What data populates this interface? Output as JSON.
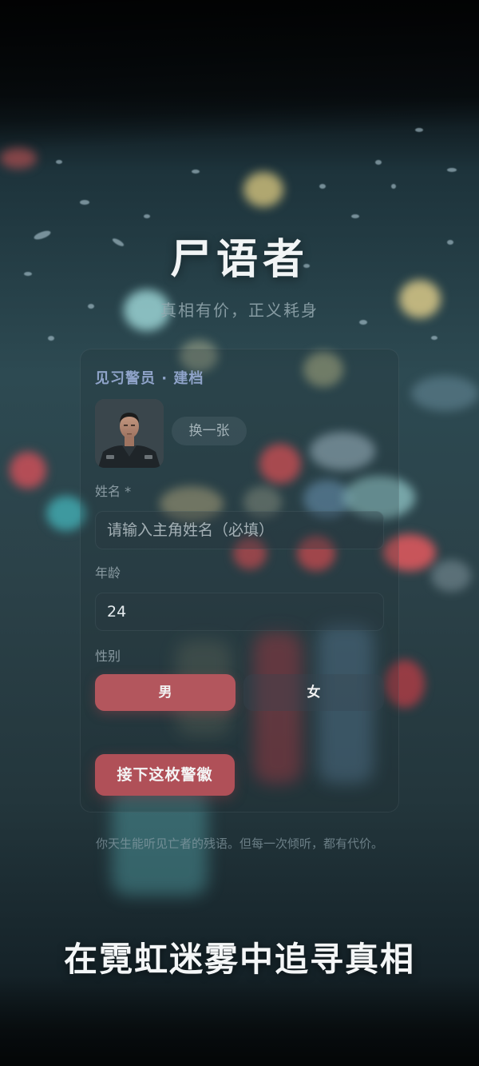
{
  "header": {
    "title": "尸语者",
    "subtitle": "真相有价，正义耗身"
  },
  "form": {
    "heading": "见习警员 · 建档",
    "avatar_icon": "portrait-photo",
    "change_photo_label": "换一张",
    "name": {
      "label": "姓名 *",
      "placeholder": "请输入主角姓名（必填）",
      "value": ""
    },
    "age": {
      "label": "年龄",
      "value": "24"
    },
    "gender": {
      "label": "性别",
      "options": [
        "男",
        "女"
      ],
      "selected": "男"
    },
    "submit_label": "接下这枚警徽"
  },
  "footnote": "你天生能听见亡者的残语。但每一次倾听，都有代价。",
  "tagline": "在霓虹迷雾中追寻真相",
  "colors": {
    "accent": "#b3565d",
    "heading": "#8fa3c9",
    "background": "#1d333b"
  }
}
